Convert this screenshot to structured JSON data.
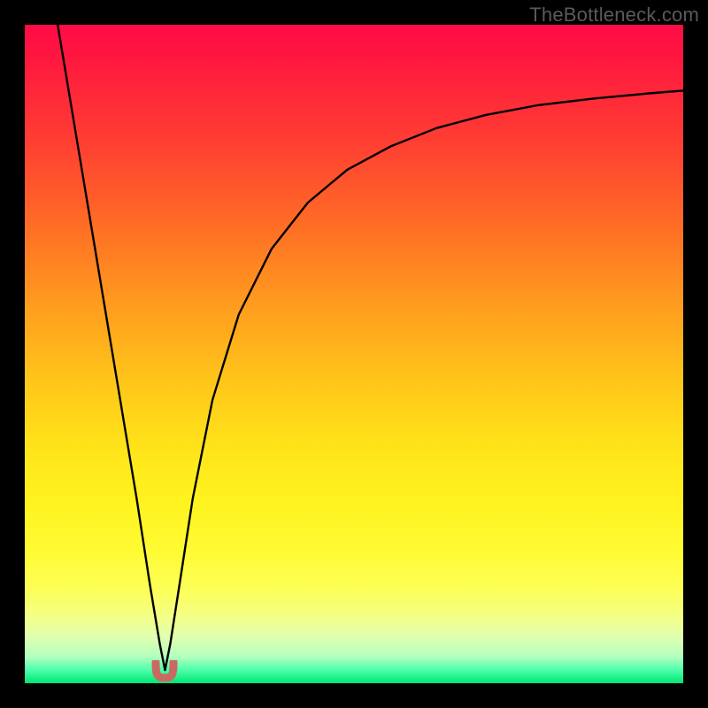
{
  "watermark": "TheBottleneck.com",
  "chart_data": {
    "type": "line",
    "title": "",
    "xlabel": "",
    "ylabel": "",
    "xlim": [
      0,
      1
    ],
    "ylim": [
      0,
      1
    ],
    "grid": false,
    "legend": false,
    "notes": "Normalized coordinates (fraction of plot area). No visible axis ticks or labels in image.",
    "series": [
      {
        "name": "bottleneck-curve",
        "color": "#000000",
        "x": [
          0.05,
          0.08,
          0.11,
          0.14,
          0.17,
          0.19,
          0.205,
          0.213,
          0.221,
          0.235,
          0.255,
          0.285,
          0.325,
          0.375,
          0.43,
          0.49,
          0.555,
          0.625,
          0.7,
          0.78,
          0.865,
          0.95,
          1.0
        ],
        "y": [
          1.0,
          0.82,
          0.64,
          0.46,
          0.28,
          0.15,
          0.06,
          0.02,
          0.06,
          0.15,
          0.28,
          0.43,
          0.56,
          0.66,
          0.73,
          0.78,
          0.815,
          0.843,
          0.863,
          0.878,
          0.888,
          0.896,
          0.9
        ]
      }
    ],
    "marker": {
      "name": "optimal-point",
      "shape": "u",
      "color": "#c96a62",
      "x": 0.213,
      "y": 0.02
    },
    "background_gradient": {
      "top": "#ff0b46",
      "mid": "#ffd11a",
      "bottom": "#00e574"
    }
  }
}
